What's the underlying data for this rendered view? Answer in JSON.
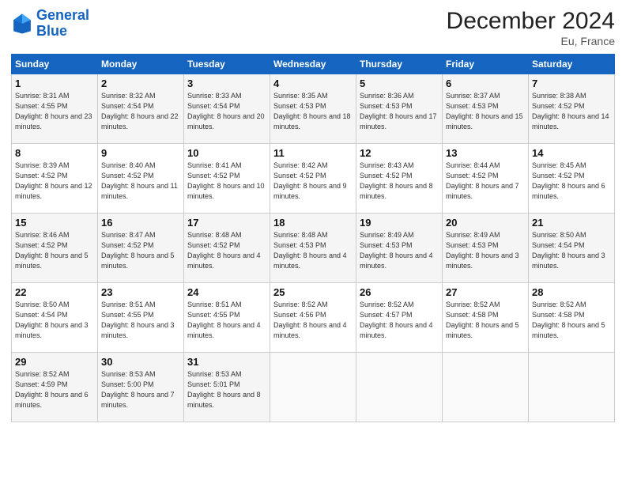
{
  "header": {
    "logo_line1": "General",
    "logo_line2": "Blue",
    "month": "December 2024",
    "location": "Eu, France"
  },
  "weekdays": [
    "Sunday",
    "Monday",
    "Tuesday",
    "Wednesday",
    "Thursday",
    "Friday",
    "Saturday"
  ],
  "weeks": [
    [
      {
        "day": "1",
        "sunrise": "Sunrise: 8:31 AM",
        "sunset": "Sunset: 4:55 PM",
        "daylight": "Daylight: 8 hours and 23 minutes."
      },
      {
        "day": "2",
        "sunrise": "Sunrise: 8:32 AM",
        "sunset": "Sunset: 4:54 PM",
        "daylight": "Daylight: 8 hours and 22 minutes."
      },
      {
        "day": "3",
        "sunrise": "Sunrise: 8:33 AM",
        "sunset": "Sunset: 4:54 PM",
        "daylight": "Daylight: 8 hours and 20 minutes."
      },
      {
        "day": "4",
        "sunrise": "Sunrise: 8:35 AM",
        "sunset": "Sunset: 4:53 PM",
        "daylight": "Daylight: 8 hours and 18 minutes."
      },
      {
        "day": "5",
        "sunrise": "Sunrise: 8:36 AM",
        "sunset": "Sunset: 4:53 PM",
        "daylight": "Daylight: 8 hours and 17 minutes."
      },
      {
        "day": "6",
        "sunrise": "Sunrise: 8:37 AM",
        "sunset": "Sunset: 4:53 PM",
        "daylight": "Daylight: 8 hours and 15 minutes."
      },
      {
        "day": "7",
        "sunrise": "Sunrise: 8:38 AM",
        "sunset": "Sunset: 4:52 PM",
        "daylight": "Daylight: 8 hours and 14 minutes."
      }
    ],
    [
      {
        "day": "8",
        "sunrise": "Sunrise: 8:39 AM",
        "sunset": "Sunset: 4:52 PM",
        "daylight": "Daylight: 8 hours and 12 minutes."
      },
      {
        "day": "9",
        "sunrise": "Sunrise: 8:40 AM",
        "sunset": "Sunset: 4:52 PM",
        "daylight": "Daylight: 8 hours and 11 minutes."
      },
      {
        "day": "10",
        "sunrise": "Sunrise: 8:41 AM",
        "sunset": "Sunset: 4:52 PM",
        "daylight": "Daylight: 8 hours and 10 minutes."
      },
      {
        "day": "11",
        "sunrise": "Sunrise: 8:42 AM",
        "sunset": "Sunset: 4:52 PM",
        "daylight": "Daylight: 8 hours and 9 minutes."
      },
      {
        "day": "12",
        "sunrise": "Sunrise: 8:43 AM",
        "sunset": "Sunset: 4:52 PM",
        "daylight": "Daylight: 8 hours and 8 minutes."
      },
      {
        "day": "13",
        "sunrise": "Sunrise: 8:44 AM",
        "sunset": "Sunset: 4:52 PM",
        "daylight": "Daylight: 8 hours and 7 minutes."
      },
      {
        "day": "14",
        "sunrise": "Sunrise: 8:45 AM",
        "sunset": "Sunset: 4:52 PM",
        "daylight": "Daylight: 8 hours and 6 minutes."
      }
    ],
    [
      {
        "day": "15",
        "sunrise": "Sunrise: 8:46 AM",
        "sunset": "Sunset: 4:52 PM",
        "daylight": "Daylight: 8 hours and 5 minutes."
      },
      {
        "day": "16",
        "sunrise": "Sunrise: 8:47 AM",
        "sunset": "Sunset: 4:52 PM",
        "daylight": "Daylight: 8 hours and 5 minutes."
      },
      {
        "day": "17",
        "sunrise": "Sunrise: 8:48 AM",
        "sunset": "Sunset: 4:52 PM",
        "daylight": "Daylight: 8 hours and 4 minutes."
      },
      {
        "day": "18",
        "sunrise": "Sunrise: 8:48 AM",
        "sunset": "Sunset: 4:53 PM",
        "daylight": "Daylight: 8 hours and 4 minutes."
      },
      {
        "day": "19",
        "sunrise": "Sunrise: 8:49 AM",
        "sunset": "Sunset: 4:53 PM",
        "daylight": "Daylight: 8 hours and 4 minutes."
      },
      {
        "day": "20",
        "sunrise": "Sunrise: 8:49 AM",
        "sunset": "Sunset: 4:53 PM",
        "daylight": "Daylight: 8 hours and 3 minutes."
      },
      {
        "day": "21",
        "sunrise": "Sunrise: 8:50 AM",
        "sunset": "Sunset: 4:54 PM",
        "daylight": "Daylight: 8 hours and 3 minutes."
      }
    ],
    [
      {
        "day": "22",
        "sunrise": "Sunrise: 8:50 AM",
        "sunset": "Sunset: 4:54 PM",
        "daylight": "Daylight: 8 hours and 3 minutes."
      },
      {
        "day": "23",
        "sunrise": "Sunrise: 8:51 AM",
        "sunset": "Sunset: 4:55 PM",
        "daylight": "Daylight: 8 hours and 3 minutes."
      },
      {
        "day": "24",
        "sunrise": "Sunrise: 8:51 AM",
        "sunset": "Sunset: 4:55 PM",
        "daylight": "Daylight: 8 hours and 4 minutes."
      },
      {
        "day": "25",
        "sunrise": "Sunrise: 8:52 AM",
        "sunset": "Sunset: 4:56 PM",
        "daylight": "Daylight: 8 hours and 4 minutes."
      },
      {
        "day": "26",
        "sunrise": "Sunrise: 8:52 AM",
        "sunset": "Sunset: 4:57 PM",
        "daylight": "Daylight: 8 hours and 4 minutes."
      },
      {
        "day": "27",
        "sunrise": "Sunrise: 8:52 AM",
        "sunset": "Sunset: 4:58 PM",
        "daylight": "Daylight: 8 hours and 5 minutes."
      },
      {
        "day": "28",
        "sunrise": "Sunrise: 8:52 AM",
        "sunset": "Sunset: 4:58 PM",
        "daylight": "Daylight: 8 hours and 5 minutes."
      }
    ],
    [
      {
        "day": "29",
        "sunrise": "Sunrise: 8:52 AM",
        "sunset": "Sunset: 4:59 PM",
        "daylight": "Daylight: 8 hours and 6 minutes."
      },
      {
        "day": "30",
        "sunrise": "Sunrise: 8:53 AM",
        "sunset": "Sunset: 5:00 PM",
        "daylight": "Daylight: 8 hours and 7 minutes."
      },
      {
        "day": "31",
        "sunrise": "Sunrise: 8:53 AM",
        "sunset": "Sunset: 5:01 PM",
        "daylight": "Daylight: 8 hours and 8 minutes."
      },
      null,
      null,
      null,
      null
    ]
  ]
}
